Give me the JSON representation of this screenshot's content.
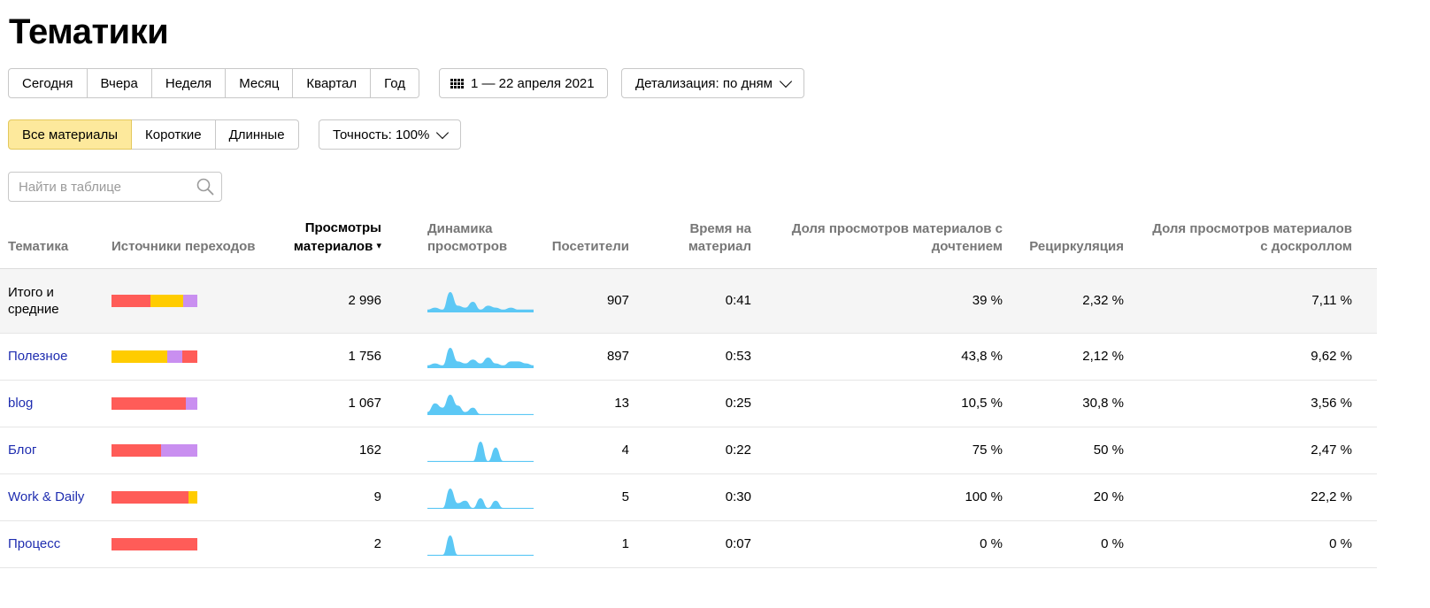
{
  "page": {
    "title": "Тематики"
  },
  "colors": {
    "source_red": "#ff5c58",
    "source_yellow": "#ffcc00",
    "source_purple": "#c98ff0",
    "spark": "#5cc8f5",
    "active_bg": "#fde99c",
    "link": "#1f2db0"
  },
  "period": {
    "items": [
      "Сегодня",
      "Вчера",
      "Неделя",
      "Месяц",
      "Квартал",
      "Год"
    ],
    "date_range": "1 — 22 апреля 2021",
    "detail": "Детализация: по дням"
  },
  "materials": {
    "items": [
      "Все материалы",
      "Короткие",
      "Длинные"
    ],
    "active": "Все материалы",
    "accuracy": "Точность: 100%"
  },
  "search": {
    "placeholder": "Найти в таблице"
  },
  "table": {
    "headers": {
      "topic": "Тематика",
      "sources": "Источники переходов",
      "views": "Просмотры материалов",
      "sort_arrow": "▾",
      "dynamics": "Динамика просмотров",
      "visitors": "Посетители",
      "time": "Время на материал",
      "read_share": "Доля просмотров материалов с дочтением",
      "recirculation": "Рециркуляция",
      "scroll_share": "Доля просмотров материалов с доскроллом"
    },
    "rows": [
      {
        "name": "Итого и средние",
        "is_total": true,
        "sources": [
          {
            "color": "red",
            "share": 0.45
          },
          {
            "color": "yellow",
            "share": 0.38
          },
          {
            "color": "purple",
            "share": 0.17
          }
        ],
        "views": "2 996",
        "spark": [
          1,
          2,
          1,
          10,
          3,
          2,
          5,
          1,
          3,
          2,
          1,
          2,
          1,
          1,
          1
        ],
        "visitors": "907",
        "time": "0:41",
        "read_share": "39 %",
        "recirculation": "2,32 %",
        "scroll_share": "7,11 %"
      },
      {
        "name": "Полезное",
        "is_total": false,
        "sources": [
          {
            "color": "yellow",
            "share": 0.65
          },
          {
            "color": "purple",
            "share": 0.17
          },
          {
            "color": "red",
            "share": 0.18
          }
        ],
        "views": "1 756",
        "spark": [
          1,
          2,
          1,
          10,
          3,
          2,
          4,
          2,
          5,
          2,
          1,
          3,
          3,
          2,
          1
        ],
        "visitors": "897",
        "time": "0:53",
        "read_share": "43,8 %",
        "recirculation": "2,12 %",
        "scroll_share": "9,62 %"
      },
      {
        "name": "blog",
        "is_total": false,
        "sources": [
          {
            "color": "red",
            "share": 0.87
          },
          {
            "color": "purple",
            "share": 0.13
          }
        ],
        "views": "1 067",
        "spark": [
          1,
          5,
          3,
          9,
          4,
          1,
          3,
          0,
          0,
          0,
          0,
          0,
          0,
          0,
          0
        ],
        "visitors": "13",
        "time": "0:25",
        "read_share": "10,5 %",
        "recirculation": "30,8 %",
        "scroll_share": "3,56 %"
      },
      {
        "name": "Блог",
        "is_total": false,
        "sources": [
          {
            "color": "red",
            "share": 0.58
          },
          {
            "color": "purple",
            "share": 0.42
          }
        ],
        "views": "162",
        "spark": [
          0,
          0,
          0,
          0,
          0,
          0,
          0,
          10,
          0,
          7,
          0,
          0,
          0,
          0,
          0
        ],
        "visitors": "4",
        "time": "0:22",
        "read_share": "75 %",
        "recirculation": "50 %",
        "scroll_share": "2,47 %"
      },
      {
        "name": "Work & Daily",
        "is_total": false,
        "sources": [
          {
            "color": "red",
            "share": 0.9
          },
          {
            "color": "yellow",
            "share": 0.1
          }
        ],
        "views": "9",
        "spark": [
          0,
          0,
          0,
          8,
          2,
          3,
          0,
          4,
          0,
          3,
          0,
          0,
          0,
          0,
          0
        ],
        "visitors": "5",
        "time": "0:30",
        "read_share": "100 %",
        "recirculation": "20 %",
        "scroll_share": "22,2 %"
      },
      {
        "name": "Процесс",
        "is_total": false,
        "sources": [
          {
            "color": "red",
            "share": 1.0
          }
        ],
        "views": "2",
        "spark": [
          0,
          0,
          0,
          10,
          0,
          0,
          0,
          0,
          0,
          0,
          0,
          0,
          0,
          0,
          0
        ],
        "visitors": "1",
        "time": "0:07",
        "read_share": "0 %",
        "recirculation": "0 %",
        "scroll_share": "0 %"
      }
    ]
  }
}
